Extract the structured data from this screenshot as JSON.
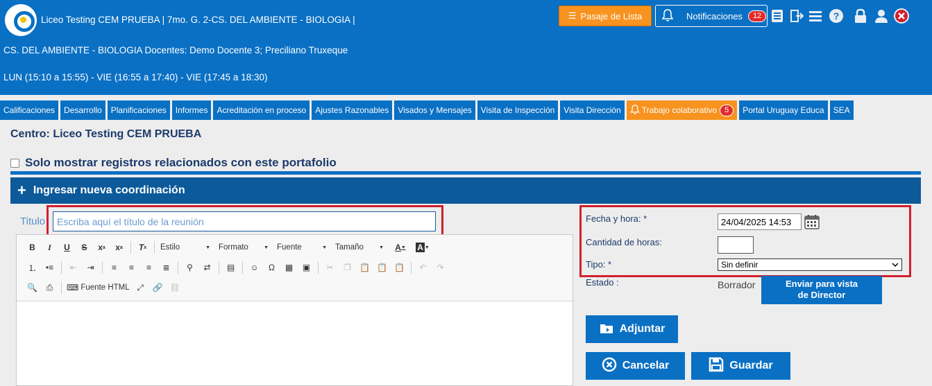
{
  "header": {
    "line1": "Liceo Testing CEM PRUEBA | 7mo. G. 2-CS. DEL AMBIENTE - BIOLOGIA |",
    "line2": "CS. DEL AMBIENTE - BIOLOGIA Docentes: Demo Docente 3; Preciliano Truxeque",
    "line3": "LUN (15:10 a 15:55) - VIE (16:55 a 17:40) - VIE (17:45 a 18:30)",
    "pasaje_label": "Pasaje de Lista",
    "notif_label": "Notificaciones",
    "notif_count": "12"
  },
  "tabs": [
    {
      "label": "Calificaciones"
    },
    {
      "label": "Desarrollo"
    },
    {
      "label": "Planificaciones"
    },
    {
      "label": "Informes"
    },
    {
      "label": "Acreditación en proceso"
    },
    {
      "label": "Ajustes Razonables"
    },
    {
      "label": "Visados y Mensajes"
    },
    {
      "label": "Visita de Inspección"
    },
    {
      "label": "Visita Dirección"
    },
    {
      "label": "Trabajo colaborativo",
      "badge": "5"
    },
    {
      "label": "Portal Uruguay Educa"
    },
    {
      "label": "SEA"
    }
  ],
  "page": {
    "centro": "Centro: Liceo Testing CEM PRUEBA",
    "solo_label": "Solo mostrar registros relacionados con este portafolio",
    "ingresar_label": "Ingresar nueva coordinación"
  },
  "form": {
    "titulo_label": "Titulo",
    "titulo_placeholder": "Escriba aquí el título de la reunión",
    "fecha_label": "Fecha y hora: *",
    "fecha_value": "24/04/2025 14:53",
    "horas_label": "Cantidad de horas:",
    "tipo_label": "Tipo: *",
    "tipo_value": "Sin definir",
    "estado_label": "Estado :",
    "estado_value": "Borrador",
    "enviar_label_1": "Enviar para vista",
    "enviar_label_2": "de Director",
    "adjuntar_label": "Adjuntar",
    "cancelar_label": "Cancelar",
    "guardar_label": "Guardar"
  },
  "editor": {
    "estilo": "Estilo",
    "formato": "Formato",
    "fuente": "Fuente",
    "tamano": "Tamaño",
    "fuente_html": "Fuente HTML"
  },
  "colors": {
    "header_blue": "#0a70c4",
    "orange": "#f7931e",
    "badge_red": "#e32b2b",
    "dark_blue": "#0c5a9a",
    "highlight_red": "#d0202c"
  }
}
